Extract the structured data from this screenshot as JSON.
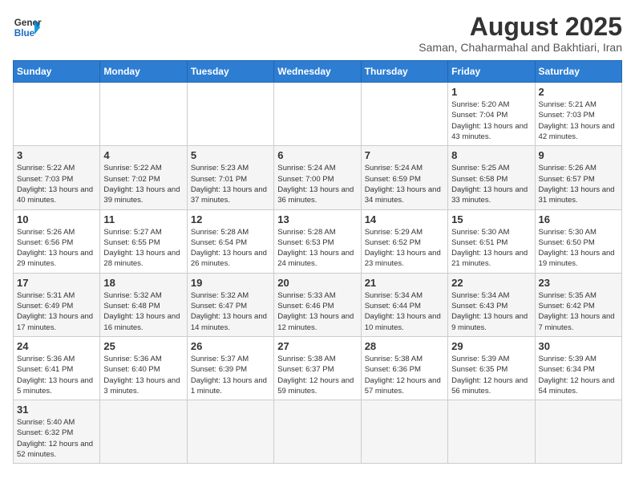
{
  "header": {
    "logo_line1": "General",
    "logo_line2": "Blue",
    "month_year": "August 2025",
    "location": "Saman, Chaharmahal and Bakhtiari, Iran"
  },
  "weekdays": [
    "Sunday",
    "Monday",
    "Tuesday",
    "Wednesday",
    "Thursday",
    "Friday",
    "Saturday"
  ],
  "weeks": [
    [
      {
        "day": "",
        "info": ""
      },
      {
        "day": "",
        "info": ""
      },
      {
        "day": "",
        "info": ""
      },
      {
        "day": "",
        "info": ""
      },
      {
        "day": "",
        "info": ""
      },
      {
        "day": "1",
        "info": "Sunrise: 5:20 AM\nSunset: 7:04 PM\nDaylight: 13 hours and 43 minutes."
      },
      {
        "day": "2",
        "info": "Sunrise: 5:21 AM\nSunset: 7:03 PM\nDaylight: 13 hours and 42 minutes."
      }
    ],
    [
      {
        "day": "3",
        "info": "Sunrise: 5:22 AM\nSunset: 7:03 PM\nDaylight: 13 hours and 40 minutes."
      },
      {
        "day": "4",
        "info": "Sunrise: 5:22 AM\nSunset: 7:02 PM\nDaylight: 13 hours and 39 minutes."
      },
      {
        "day": "5",
        "info": "Sunrise: 5:23 AM\nSunset: 7:01 PM\nDaylight: 13 hours and 37 minutes."
      },
      {
        "day": "6",
        "info": "Sunrise: 5:24 AM\nSunset: 7:00 PM\nDaylight: 13 hours and 36 minutes."
      },
      {
        "day": "7",
        "info": "Sunrise: 5:24 AM\nSunset: 6:59 PM\nDaylight: 13 hours and 34 minutes."
      },
      {
        "day": "8",
        "info": "Sunrise: 5:25 AM\nSunset: 6:58 PM\nDaylight: 13 hours and 33 minutes."
      },
      {
        "day": "9",
        "info": "Sunrise: 5:26 AM\nSunset: 6:57 PM\nDaylight: 13 hours and 31 minutes."
      }
    ],
    [
      {
        "day": "10",
        "info": "Sunrise: 5:26 AM\nSunset: 6:56 PM\nDaylight: 13 hours and 29 minutes."
      },
      {
        "day": "11",
        "info": "Sunrise: 5:27 AM\nSunset: 6:55 PM\nDaylight: 13 hours and 28 minutes."
      },
      {
        "day": "12",
        "info": "Sunrise: 5:28 AM\nSunset: 6:54 PM\nDaylight: 13 hours and 26 minutes."
      },
      {
        "day": "13",
        "info": "Sunrise: 5:28 AM\nSunset: 6:53 PM\nDaylight: 13 hours and 24 minutes."
      },
      {
        "day": "14",
        "info": "Sunrise: 5:29 AM\nSunset: 6:52 PM\nDaylight: 13 hours and 23 minutes."
      },
      {
        "day": "15",
        "info": "Sunrise: 5:30 AM\nSunset: 6:51 PM\nDaylight: 13 hours and 21 minutes."
      },
      {
        "day": "16",
        "info": "Sunrise: 5:30 AM\nSunset: 6:50 PM\nDaylight: 13 hours and 19 minutes."
      }
    ],
    [
      {
        "day": "17",
        "info": "Sunrise: 5:31 AM\nSunset: 6:49 PM\nDaylight: 13 hours and 17 minutes."
      },
      {
        "day": "18",
        "info": "Sunrise: 5:32 AM\nSunset: 6:48 PM\nDaylight: 13 hours and 16 minutes."
      },
      {
        "day": "19",
        "info": "Sunrise: 5:32 AM\nSunset: 6:47 PM\nDaylight: 13 hours and 14 minutes."
      },
      {
        "day": "20",
        "info": "Sunrise: 5:33 AM\nSunset: 6:46 PM\nDaylight: 13 hours and 12 minutes."
      },
      {
        "day": "21",
        "info": "Sunrise: 5:34 AM\nSunset: 6:44 PM\nDaylight: 13 hours and 10 minutes."
      },
      {
        "day": "22",
        "info": "Sunrise: 5:34 AM\nSunset: 6:43 PM\nDaylight: 13 hours and 9 minutes."
      },
      {
        "day": "23",
        "info": "Sunrise: 5:35 AM\nSunset: 6:42 PM\nDaylight: 13 hours and 7 minutes."
      }
    ],
    [
      {
        "day": "24",
        "info": "Sunrise: 5:36 AM\nSunset: 6:41 PM\nDaylight: 13 hours and 5 minutes."
      },
      {
        "day": "25",
        "info": "Sunrise: 5:36 AM\nSunset: 6:40 PM\nDaylight: 13 hours and 3 minutes."
      },
      {
        "day": "26",
        "info": "Sunrise: 5:37 AM\nSunset: 6:39 PM\nDaylight: 13 hours and 1 minute."
      },
      {
        "day": "27",
        "info": "Sunrise: 5:38 AM\nSunset: 6:37 PM\nDaylight: 12 hours and 59 minutes."
      },
      {
        "day": "28",
        "info": "Sunrise: 5:38 AM\nSunset: 6:36 PM\nDaylight: 12 hours and 57 minutes."
      },
      {
        "day": "29",
        "info": "Sunrise: 5:39 AM\nSunset: 6:35 PM\nDaylight: 12 hours and 56 minutes."
      },
      {
        "day": "30",
        "info": "Sunrise: 5:39 AM\nSunset: 6:34 PM\nDaylight: 12 hours and 54 minutes."
      }
    ],
    [
      {
        "day": "31",
        "info": "Sunrise: 5:40 AM\nSunset: 6:32 PM\nDaylight: 12 hours and 52 minutes."
      },
      {
        "day": "",
        "info": ""
      },
      {
        "day": "",
        "info": ""
      },
      {
        "day": "",
        "info": ""
      },
      {
        "day": "",
        "info": ""
      },
      {
        "day": "",
        "info": ""
      },
      {
        "day": "",
        "info": ""
      }
    ]
  ]
}
